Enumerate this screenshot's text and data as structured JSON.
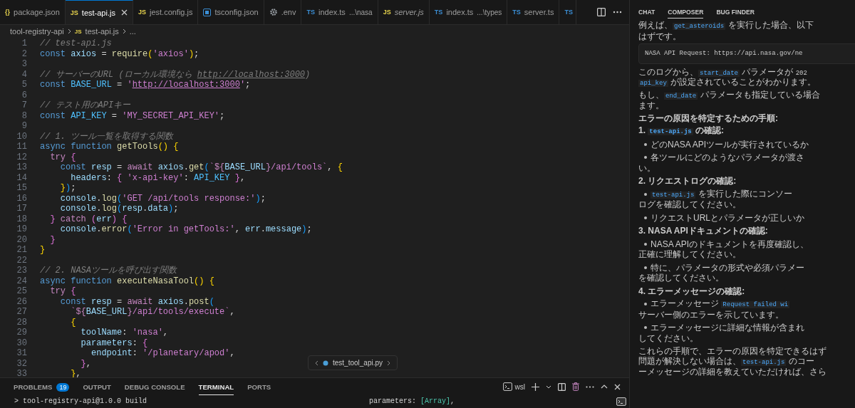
{
  "editor_tabs": [
    {
      "label": "package.json",
      "kind": "json",
      "glyph": "{}",
      "selected": false,
      "preview": false
    },
    {
      "label": "test-api.js",
      "kind": "js",
      "glyph": "JS",
      "selected": true,
      "preview": false
    },
    {
      "label": "jest.config.js",
      "kind": "js",
      "glyph": "JS",
      "selected": false,
      "preview": false
    },
    {
      "label": "tsconfig.json",
      "kind": "tsconfig",
      "selected": false,
      "preview": false
    },
    {
      "label": ".env",
      "kind": "gear",
      "selected": false,
      "preview": false
    },
    {
      "label": "index.ts",
      "detail": "...\\nasa",
      "kind": "ts",
      "glyph": "TS",
      "selected": false,
      "preview": false
    },
    {
      "label": "server.js",
      "kind": "js",
      "glyph": "JS",
      "selected": false,
      "preview": true
    },
    {
      "label": "index.ts",
      "detail": "...\\types",
      "kind": "ts",
      "glyph": "TS",
      "selected": false,
      "preview": false
    },
    {
      "label": "server.ts",
      "kind": "ts",
      "glyph": "TS",
      "selected": false,
      "preview": false
    },
    {
      "kind": "ts",
      "glyph": "TS",
      "selected": false
    }
  ],
  "breadcrumb": {
    "folder": "tool-registry-api",
    "file_glyph": "JS",
    "file": "test-api.js",
    "symbol": "..."
  },
  "code_lines": [
    {
      "number": "1",
      "tokens": [
        {
          "kind": "comment",
          "text": "// test-api.js"
        }
      ]
    },
    {
      "number": "2",
      "tokens": [
        {
          "kind": "keyword",
          "text": "const "
        },
        {
          "kind": "variable",
          "text": "axios"
        },
        {
          "kind": "plain",
          "text": " = "
        },
        {
          "kind": "function",
          "text": "require"
        },
        {
          "kind": "bracket1",
          "text": "("
        },
        {
          "kind": "string",
          "text": "'axios'"
        },
        {
          "kind": "bracket1",
          "text": ")"
        },
        {
          "kind": "plain",
          "text": ";"
        }
      ]
    },
    {
      "number": "3"
    },
    {
      "number": "4",
      "tokens": [
        {
          "kind": "comment",
          "text": "// サーバーのURL (ローカル環境なら "
        },
        {
          "kind": "commentlink",
          "text": "http://localhost:3000"
        },
        {
          "kind": "comment",
          "text": ")"
        }
      ]
    },
    {
      "number": "5",
      "tokens": [
        {
          "kind": "keyword",
          "text": "const "
        },
        {
          "kind": "constant",
          "text": "BASE_URL"
        },
        {
          "kind": "plain",
          "text": " = "
        },
        {
          "kind": "string",
          "text": "'"
        },
        {
          "kind": "link",
          "text": "http://localhost:3000"
        },
        {
          "kind": "string",
          "text": "'"
        },
        {
          "kind": "plain",
          "text": ";"
        }
      ]
    },
    {
      "number": "6"
    },
    {
      "number": "7",
      "tokens": [
        {
          "kind": "comment",
          "text": "// テスト用のAPIキー"
        }
      ]
    },
    {
      "number": "8",
      "tokens": [
        {
          "kind": "keyword",
          "text": "const "
        },
        {
          "kind": "constant",
          "text": "API_KEY"
        },
        {
          "kind": "plain",
          "text": " = "
        },
        {
          "kind": "string",
          "text": "'MY_SECRET_API_KEY'"
        },
        {
          "kind": "plain",
          "text": ";"
        }
      ]
    },
    {
      "number": "9"
    },
    {
      "number": "10",
      "tokens": [
        {
          "kind": "comment",
          "text": "// 1. ツール一覧を取得する関数"
        }
      ]
    },
    {
      "number": "11",
      "tokens": [
        {
          "kind": "keyword",
          "text": "async function "
        },
        {
          "kind": "function",
          "text": "getTools"
        },
        {
          "kind": "bracket1",
          "text": "()"
        },
        {
          "kind": "bracket1",
          "text": " {"
        }
      ]
    },
    {
      "number": "12",
      "tokens": [
        {
          "kind": "control",
          "text": "  try"
        },
        {
          "kind": "bracket2",
          "text": " {"
        }
      ]
    },
    {
      "number": "13",
      "tokens": [
        {
          "kind": "keyword",
          "text": "    const "
        },
        {
          "kind": "variable",
          "text": "resp"
        },
        {
          "kind": "plain",
          "text": " = "
        },
        {
          "kind": "control",
          "text": "await "
        },
        {
          "kind": "variable",
          "text": "axios"
        },
        {
          "kind": "plain",
          "text": "."
        },
        {
          "kind": "function",
          "text": "get"
        },
        {
          "kind": "bracket3",
          "text": "("
        },
        {
          "kind": "string",
          "text": "`"
        },
        {
          "kind": "control",
          "text": "${"
        },
        {
          "kind": "variable",
          "text": "BASE_URL"
        },
        {
          "kind": "control",
          "text": "}"
        },
        {
          "kind": "string",
          "text": "/api/tools`"
        },
        {
          "kind": "plain",
          "text": ", "
        },
        {
          "kind": "bracket1",
          "text": "{"
        }
      ]
    },
    {
      "number": "14",
      "tokens": [
        {
          "kind": "variable",
          "text": "      headers"
        },
        {
          "kind": "plain",
          "text": ": "
        },
        {
          "kind": "bracket2",
          "text": "{ "
        },
        {
          "kind": "string",
          "text": "'x-api-key'"
        },
        {
          "kind": "plain",
          "text": ": "
        },
        {
          "kind": "constant",
          "text": "API_KEY"
        },
        {
          "kind": "bracket2",
          "text": " }"
        },
        {
          "kind": "plain",
          "text": ","
        }
      ]
    },
    {
      "number": "15",
      "tokens": [
        {
          "kind": "bracket1",
          "text": "    }"
        },
        {
          "kind": "bracket3",
          "text": ")"
        },
        {
          "kind": "plain",
          "text": ";"
        }
      ]
    },
    {
      "number": "16",
      "tokens": [
        {
          "kind": "variable",
          "text": "    console"
        },
        {
          "kind": "plain",
          "text": "."
        },
        {
          "kind": "function",
          "text": "log"
        },
        {
          "kind": "bracket3",
          "text": "("
        },
        {
          "kind": "string",
          "text": "'GET /api/tools response:'"
        },
        {
          "kind": "bracket3",
          "text": ")"
        },
        {
          "kind": "plain",
          "text": ";"
        }
      ]
    },
    {
      "number": "17",
      "tokens": [
        {
          "kind": "variable",
          "text": "    console"
        },
        {
          "kind": "plain",
          "text": "."
        },
        {
          "kind": "function",
          "text": "log"
        },
        {
          "kind": "bracket3",
          "text": "("
        },
        {
          "kind": "variable",
          "text": "resp"
        },
        {
          "kind": "plain",
          "text": "."
        },
        {
          "kind": "variable",
          "text": "data"
        },
        {
          "kind": "bracket3",
          "text": ")"
        },
        {
          "kind": "plain",
          "text": ";"
        }
      ]
    },
    {
      "number": "18",
      "tokens": [
        {
          "kind": "bracket2",
          "text": "  }"
        },
        {
          "kind": "control",
          "text": " catch"
        },
        {
          "kind": "bracket2",
          "text": " ("
        },
        {
          "kind": "variable",
          "text": "err"
        },
        {
          "kind": "bracket2",
          "text": ")"
        },
        {
          "kind": "bracket2",
          "text": " {"
        }
      ]
    },
    {
      "number": "19",
      "tokens": [
        {
          "kind": "variable",
          "text": "    console"
        },
        {
          "kind": "plain",
          "text": "."
        },
        {
          "kind": "function",
          "text": "error"
        },
        {
          "kind": "bracket3",
          "text": "("
        },
        {
          "kind": "string",
          "text": "'Error in getTools:'"
        },
        {
          "kind": "plain",
          "text": ", "
        },
        {
          "kind": "variable",
          "text": "err"
        },
        {
          "kind": "plain",
          "text": "."
        },
        {
          "kind": "variable",
          "text": "message"
        },
        {
          "kind": "bracket3",
          "text": ")"
        },
        {
          "kind": "plain",
          "text": ";"
        }
      ]
    },
    {
      "number": "20",
      "tokens": [
        {
          "kind": "bracket2",
          "text": "  }"
        }
      ]
    },
    {
      "number": "21",
      "tokens": [
        {
          "kind": "bracket1",
          "text": "}"
        }
      ]
    },
    {
      "number": "22"
    },
    {
      "number": "23",
      "tokens": [
        {
          "kind": "comment",
          "text": "// 2. NASAツールを呼び出す関数"
        }
      ]
    },
    {
      "number": "24",
      "tokens": [
        {
          "kind": "keyword",
          "text": "async function "
        },
        {
          "kind": "function",
          "text": "executeNasaTool"
        },
        {
          "kind": "bracket1",
          "text": "()"
        },
        {
          "kind": "bracket1",
          "text": " {"
        }
      ]
    },
    {
      "number": "25",
      "tokens": [
        {
          "kind": "control",
          "text": "  try"
        },
        {
          "kind": "bracket2",
          "text": " {"
        }
      ]
    },
    {
      "number": "26",
      "tokens": [
        {
          "kind": "keyword",
          "text": "    const "
        },
        {
          "kind": "variable",
          "text": "resp"
        },
        {
          "kind": "plain",
          "text": " = "
        },
        {
          "kind": "control",
          "text": "await "
        },
        {
          "kind": "variable",
          "text": "axios"
        },
        {
          "kind": "plain",
          "text": "."
        },
        {
          "kind": "function",
          "text": "post"
        },
        {
          "kind": "bracket3",
          "text": "("
        }
      ]
    },
    {
      "number": "27",
      "tokens": [
        {
          "kind": "string",
          "text": "      `"
        },
        {
          "kind": "control",
          "text": "${"
        },
        {
          "kind": "variable",
          "text": "BASE_URL"
        },
        {
          "kind": "control",
          "text": "}"
        },
        {
          "kind": "string",
          "text": "/api/tools/execute`"
        },
        {
          "kind": "plain",
          "text": ","
        }
      ]
    },
    {
      "number": "28",
      "tokens": [
        {
          "kind": "bracket1",
          "text": "      {"
        }
      ]
    },
    {
      "number": "29",
      "tokens": [
        {
          "kind": "variable",
          "text": "        toolName"
        },
        {
          "kind": "plain",
          "text": ": "
        },
        {
          "kind": "string",
          "text": "'nasa'"
        },
        {
          "kind": "plain",
          "text": ","
        }
      ]
    },
    {
      "number": "30",
      "tokens": [
        {
          "kind": "variable",
          "text": "        parameters"
        },
        {
          "kind": "plain",
          "text": ": "
        },
        {
          "kind": "bracket2",
          "text": "{"
        }
      ]
    },
    {
      "number": "31",
      "tokens": [
        {
          "kind": "variable",
          "text": "          endpoint"
        },
        {
          "kind": "plain",
          "text": ": "
        },
        {
          "kind": "string",
          "text": "'/planetary/apod'"
        },
        {
          "kind": "plain",
          "text": ","
        }
      ]
    },
    {
      "number": "32",
      "tokens": [
        {
          "kind": "bracket2",
          "text": "        }"
        },
        {
          "kind": "plain",
          "text": ","
        }
      ]
    },
    {
      "number": "33",
      "tokens": [
        {
          "kind": "bracket1",
          "text": "      }"
        },
        {
          "kind": "plain",
          "text": ","
        }
      ]
    }
  ],
  "sticky_widget": {
    "file": "test_tool_api.py"
  },
  "panel": {
    "tabs": [
      {
        "label": "PROBLEMS",
        "badge": "19",
        "selected": false
      },
      {
        "label": "OUTPUT",
        "selected": false
      },
      {
        "label": "DEBUG CONSOLE",
        "selected": false
      },
      {
        "label": "TERMINAL",
        "selected": true
      },
      {
        "label": "PORTS",
        "selected": false
      }
    ],
    "terminal_profile": "wsl",
    "panes": [
      [
        {
          "kind": "plain",
          "text": "> tool-registry-api@1.0.0 build"
        }
      ],
      [
        {
          "kind": "plain",
          "text": "parameters: "
        },
        {
          "kind": "green",
          "text": "[Array]"
        },
        {
          "kind": "plain",
          "text": ","
        }
      ]
    ]
  },
  "chat": {
    "tabs": [
      {
        "label": "CHAT",
        "selected": false
      },
      {
        "label": "COMPOSER",
        "selected": true
      },
      {
        "label": "BUG FINDER",
        "selected": false
      }
    ],
    "blocks": [
      {
        "kind": "para",
        "lines": [
          [
            {
              "kind": "text",
              "text": "例えば、"
            },
            {
              "kind": "code",
              "text": "get_asteroids"
            },
            {
              "kind": "text",
              "text": " を実行した場合、以下"
            }
          ],
          [
            {
              "kind": "text",
              "text": "はずです。"
            }
          ]
        ]
      },
      {
        "kind": "codeblock",
        "lines": [
          [
            {
              "kind": "text",
              "text": "NASA API Request: https://api.nasa.gov/ne"
            }
          ]
        ]
      },
      {
        "kind": "para",
        "lines": [
          [
            {
              "kind": "text",
              "text": "このログから、"
            },
            {
              "kind": "code",
              "text": "start_date"
            },
            {
              "kind": "text",
              "text": " パラメータが "
            },
            {
              "kind": "mono",
              "text": "202"
            }
          ],
          [
            {
              "kind": "code",
              "text": "api_key"
            },
            {
              "kind": "text",
              "text": " が設定されていることがわかります。"
            }
          ]
        ]
      },
      {
        "kind": "para",
        "lines": [
          [
            {
              "kind": "text",
              "text": "もし、"
            },
            {
              "kind": "code",
              "text": "end_date"
            },
            {
              "kind": "text",
              "text": " パラメータも指定している場合"
            }
          ],
          [
            {
              "kind": "text",
              "text": "ます。"
            }
          ]
        ]
      },
      {
        "kind": "heading",
        "lines": [
          [
            {
              "kind": "text",
              "text": "エラーの原因を特定するための手順:"
            }
          ]
        ]
      },
      {
        "kind": "heading",
        "lines": [
          [
            {
              "kind": "text",
              "text": "1. "
            },
            {
              "kind": "code",
              "text": "test-api.js"
            },
            {
              "kind": "text",
              "text": " の確認:"
            }
          ]
        ]
      },
      {
        "kind": "bullet",
        "lines": [
          [
            {
              "kind": "text",
              "text": "どのNASA APIツールが実行されているか"
            }
          ]
        ]
      },
      {
        "kind": "bullet",
        "lines": [
          [
            {
              "kind": "text",
              "text": "各ツールにどのようなパラメータが渡さ"
            }
          ],
          [
            {
              "kind": "text",
              "text": "い。"
            }
          ]
        ]
      },
      {
        "kind": "heading",
        "lines": [
          [
            {
              "kind": "text",
              "text": "2. リクエストログの確認:"
            }
          ]
        ]
      },
      {
        "kind": "bullet",
        "lines": [
          [
            {
              "kind": "code",
              "text": "test-api.js"
            },
            {
              "kind": "text",
              "text": " を実行した際にコンソー"
            }
          ],
          [
            {
              "kind": "text",
              "text": "ログを確認してください。"
            }
          ]
        ]
      },
      {
        "kind": "bullet",
        "lines": [
          [
            {
              "kind": "text",
              "text": "リクエストURLとパラメータが正しいか"
            }
          ]
        ]
      },
      {
        "kind": "heading",
        "lines": [
          [
            {
              "kind": "text",
              "text": "3. NASA APIドキュメントの確認:"
            }
          ]
        ]
      },
      {
        "kind": "bullet",
        "lines": [
          [
            {
              "kind": "text",
              "text": "NASA APIのドキュメントを再度確認し、"
            }
          ],
          [
            {
              "kind": "text",
              "text": "正確に理解してください。"
            }
          ]
        ]
      },
      {
        "kind": "bullet",
        "lines": [
          [
            {
              "kind": "text",
              "text": "特に、パラメータの形式や必須パラメー"
            }
          ],
          [
            {
              "kind": "text",
              "text": "を確認してください。"
            }
          ]
        ]
      },
      {
        "kind": "heading",
        "lines": [
          [
            {
              "kind": "text",
              "text": "4. エラーメッセージの確認:"
            }
          ]
        ]
      },
      {
        "kind": "bullet",
        "lines": [
          [
            {
              "kind": "text",
              "text": "エラーメッセージ "
            },
            {
              "kind": "code",
              "text": "Request failed wi"
            }
          ],
          [
            {
              "kind": "text",
              "text": "サーバー側のエラーを示しています。"
            }
          ]
        ]
      },
      {
        "kind": "bullet",
        "lines": [
          [
            {
              "kind": "text",
              "text": "エラーメッセージに詳細な情報が含まれ"
            }
          ],
          [
            {
              "kind": "text",
              "text": "してください。"
            }
          ]
        ]
      },
      {
        "kind": "para",
        "lines": [
          [
            {
              "kind": "text",
              "text": "これらの手順で、エラーの原因を特定できるはず"
            }
          ],
          [
            {
              "kind": "text",
              "text": "問題が解決しない場合は、"
            },
            {
              "kind": "code",
              "text": "test-api.js"
            },
            {
              "kind": "text",
              "text": " のコー"
            }
          ],
          [
            {
              "kind": "text",
              "text": "ーメッセージの詳細を教えていただければ、さら"
            }
          ]
        ]
      }
    ]
  }
}
